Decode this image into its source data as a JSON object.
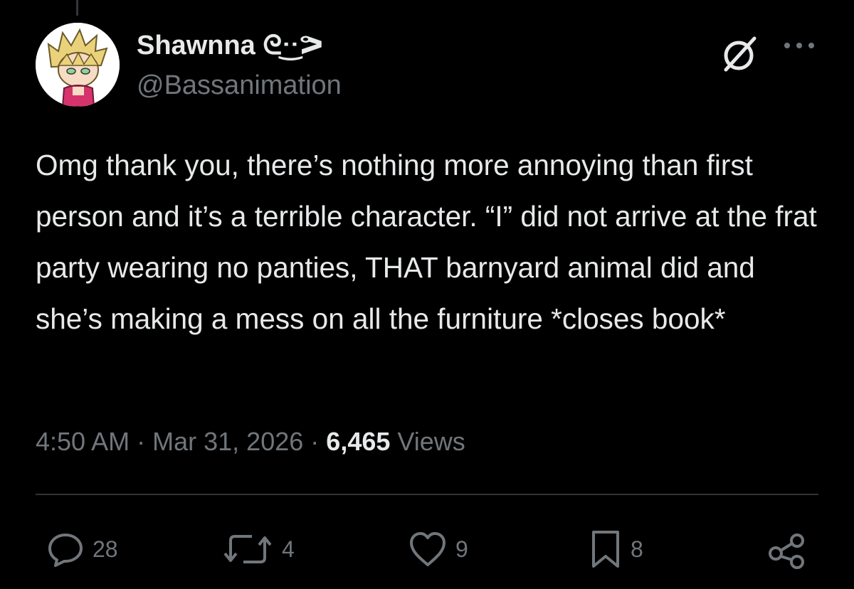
{
  "tweet": {
    "author": {
      "display_name": "Shawnna ᘓᐧ͜ᐧᕗ",
      "handle": "@Bassanimation"
    },
    "text": "Omg thank you, there’s nothing more annoying than first person and it’s a terrible character. “I” did not arrive at the frat party wearing no panties, THAT barnyard animal did and she’s making a mess on all the furniture *closes book*",
    "time": "4:50 AM",
    "separator": "·",
    "date": "Mar 31, 2026",
    "views_count": "6,465",
    "views_label": "Views"
  },
  "actions": {
    "replies": "28",
    "reposts": "4",
    "likes": "9",
    "bookmarks": "8"
  },
  "icons": [
    "grok-icon",
    "more-icon",
    "reply-icon",
    "repost-icon",
    "like-icon",
    "bookmark-icon",
    "share-icon"
  ],
  "colors": {
    "background": "#000000",
    "primary_text": "#e7e9ea",
    "secondary_text": "#71767b",
    "divider": "#2f3336"
  }
}
